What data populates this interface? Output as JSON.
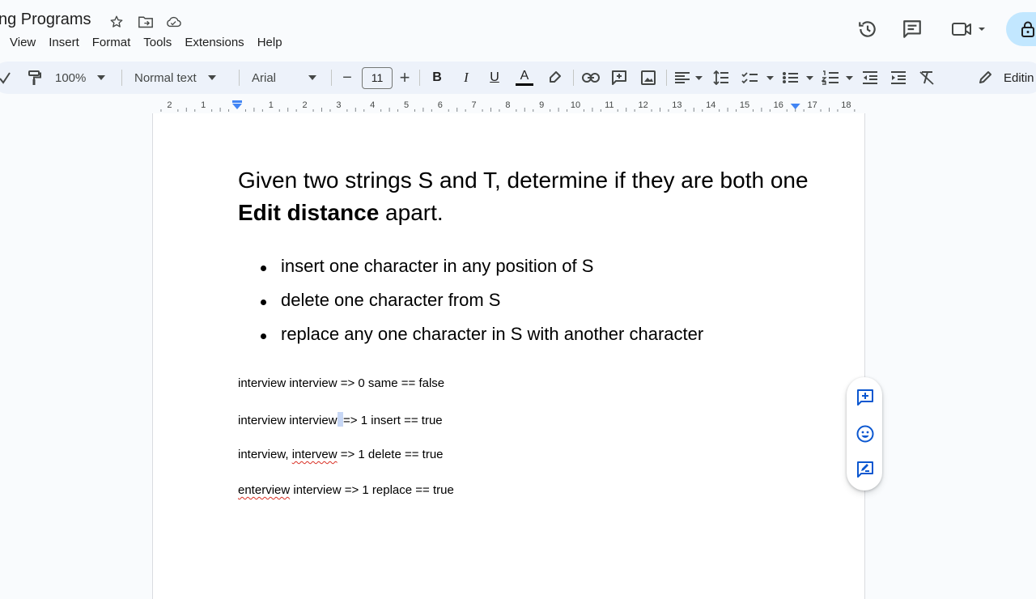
{
  "app": {
    "doc_title": "ng Programs",
    "menu": [
      "View",
      "Insert",
      "Format",
      "Tools",
      "Extensions",
      "Help"
    ]
  },
  "header_icons": [
    "star-icon",
    "move-to-folder-icon",
    "cloud-saved-icon",
    "version-history-icon",
    "comments-icon",
    "meet-video-icon",
    "lock-icon"
  ],
  "toolbar": {
    "zoom": "100%",
    "style": "Normal text",
    "font": "Arial",
    "font_size": "11",
    "minus": "−",
    "plus": "+",
    "bold": "B",
    "italic": "I",
    "underline": "U",
    "text_color_letter": "A",
    "mode_label": "Editin"
  },
  "ruler": {
    "labels": [
      "2",
      "1",
      "1",
      "2",
      "3",
      "4",
      "5",
      "6",
      "7",
      "8",
      "9",
      "10",
      "11",
      "12",
      "13",
      "14",
      "15",
      "16",
      "17",
      "18"
    ]
  },
  "document": {
    "heading_part1": "Given two strings S and T, determine if they are both one ",
    "heading_bold": "Edit distance",
    "heading_part2": " apart.",
    "bullets": [
      "insert one character in any position of S",
      "delete one character from S",
      "replace any one character in S with another character"
    ],
    "examples": {
      "ex1": "interview interview => 0 same == false",
      "ex2_a": "interview interviews",
      "ex2_b": "=> 1 insert == true",
      "ex3_a": "interview, ",
      "ex3_misspelled": "intervew",
      "ex3_b": " => 1 delete == true",
      "ex4_misspelled": "enterview",
      "ex4_b": " interview => 1 replace == true"
    }
  },
  "colors": {
    "toolbar_bg": "#edf2fa",
    "accent_blue": "#0b57d0",
    "spellcheck_red": "#d93025",
    "lock_pill": "#c2e7ff"
  },
  "side_panel": [
    "add-comment-icon",
    "emoji-reaction-icon",
    "suggest-edits-icon"
  ]
}
